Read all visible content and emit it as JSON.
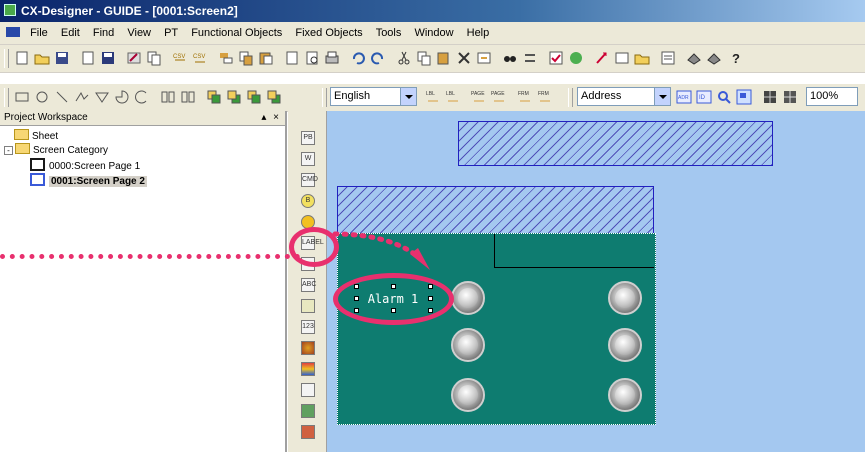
{
  "window": {
    "title": "CX-Designer - GUIDE - [0001:Screen2]"
  },
  "menu": [
    {
      "label": "File"
    },
    {
      "label": "Edit"
    },
    {
      "label": "Find"
    },
    {
      "label": "View"
    },
    {
      "label": "PT"
    },
    {
      "label": "Functional Objects"
    },
    {
      "label": "Fixed Objects"
    },
    {
      "label": "Tools"
    },
    {
      "label": "Window"
    },
    {
      "label": "Help"
    }
  ],
  "toolbar3": {
    "language": "English",
    "address": "Address",
    "zoom": "100%",
    "lbl_label": "LBL",
    "page_label": "PAGE",
    "frm_label": "FRM",
    "adr_label": "ADR",
    "id_label": "ID"
  },
  "workspace": {
    "title": "Project Workspace",
    "controls": "▴ ×",
    "nodes": [
      {
        "label": "Sheet"
      },
      {
        "label": "Screen Category"
      },
      {
        "label": "0000:Screen Page 1"
      },
      {
        "label": "0001:Screen Page 2"
      }
    ]
  },
  "objects_bar": [
    "PB",
    "W",
    "CMD",
    "B",
    "",
    "LABEL",
    "",
    "ABC",
    "",
    "123",
    "",
    "",
    "",
    "",
    ""
  ],
  "screen": {
    "alarm_text": "Alarm 1"
  },
  "colors": {
    "canvas": "#a4c8f0",
    "screen": "#0e7c70",
    "annotation": "#e8306e",
    "hatch": "#5050b8"
  }
}
